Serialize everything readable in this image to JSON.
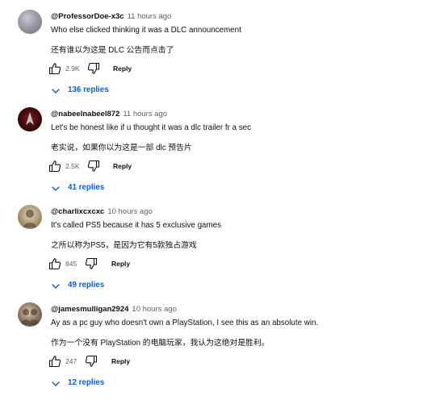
{
  "comments": [
    {
      "author": "@ProfessorDoe-x3c",
      "time": "11 hours ago",
      "text": "Who else clicked thinking it was a DLC announcement",
      "translation": "还有谁以为这是 DLC 公告而点击了",
      "likes": "2.9K",
      "reply_label": "Reply",
      "replies_label": "136 replies"
    },
    {
      "author": "@nabeelnabeel872",
      "time": "11 hours ago",
      "text": "Let's be honest like if u thought it was a dlc trailer fr a sec",
      "translation": "老实说，如果你以为这是一部 dlc 预告片",
      "likes": "2.5K",
      "reply_label": "Reply",
      "replies_label": "41 replies"
    },
    {
      "author": "@charlixcxcxc",
      "time": "10 hours ago",
      "text": "It's called PS5 because it has 5 exclusive games",
      "translation": "之所以称为PS5，是因为它有5款独占游戏",
      "likes": "845",
      "reply_label": "Reply",
      "replies_label": "49 replies"
    },
    {
      "author": "@jamesmulligan2924",
      "time": "10 hours ago",
      "text": "Ay as a pc guy who doesn't own a PlayStation, I see this as an absolute win.",
      "translation": "作为一个没有 PlayStation 的电脑玩家，我认为这绝对是胜利。",
      "likes": "247",
      "reply_label": "Reply",
      "replies_label": "12 replies"
    }
  ],
  "colors": {
    "link": "#065fd4",
    "meta": "#606060",
    "text": "#0f0f0f"
  },
  "icons": [
    "thumb-up-icon",
    "thumb-down-icon",
    "chevron-down-icon"
  ]
}
